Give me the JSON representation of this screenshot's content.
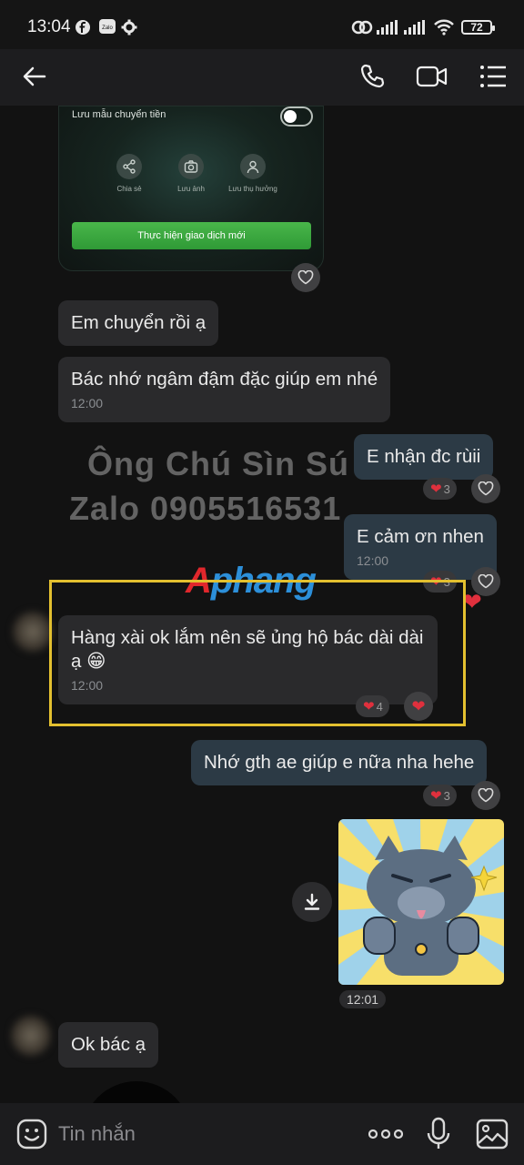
{
  "status_bar": {
    "time": "13:04",
    "battery": "72"
  },
  "header": {
    "contact_name": "",
    "actions": [
      "back-arrow",
      "phone",
      "video-call",
      "menu"
    ]
  },
  "bank_card": {
    "toggle_label": "Lưu mẫu chuyển tiền",
    "actions": [
      {
        "label": "Chia sẻ",
        "icon": "share-icon"
      },
      {
        "label": "Lưu ảnh",
        "icon": "camera-icon"
      },
      {
        "label": "Lưu thụ hưởng",
        "icon": "user-icon"
      }
    ],
    "button_label": "Thực hiện giao dịch mới"
  },
  "messages": {
    "m1": {
      "text": "Em chuyển rồi ạ"
    },
    "m2": {
      "text": "Bác nhớ ngâm đậm đặc giúp em nhé",
      "time": "12:00"
    },
    "m3": {
      "text": "E nhận đc rùii",
      "reaction_count": "3"
    },
    "m4": {
      "text": "E cảm ơn nhen",
      "time": "12:00",
      "reaction_count": "3"
    },
    "m5": {
      "text": "Hàng xài ok lắm nên sẽ ủng hộ bác dài dài ạ 😁",
      "time": "12:00",
      "reaction_count": "4"
    },
    "m6": {
      "text": "Nhớ gth ae giúp e nữa nha hehe",
      "reaction_count": "3"
    },
    "sticker": {
      "time": "12:01"
    },
    "m7": {
      "text": "Ok bác ạ"
    }
  },
  "watermark": {
    "line1": "Ông Chú Sìn Sú",
    "line2": "Zalo 0905516531",
    "logo_red": "A",
    "logo_blue": "phang"
  },
  "input_bar": {
    "placeholder": "Tin nhắn"
  },
  "colors": {
    "incoming_bubble": "#2a2a2c",
    "outgoing_bubble": "#2c3a45",
    "heart": "#e0303d",
    "highlight": "#e3c02f",
    "primary_green": "#3daa3f"
  }
}
